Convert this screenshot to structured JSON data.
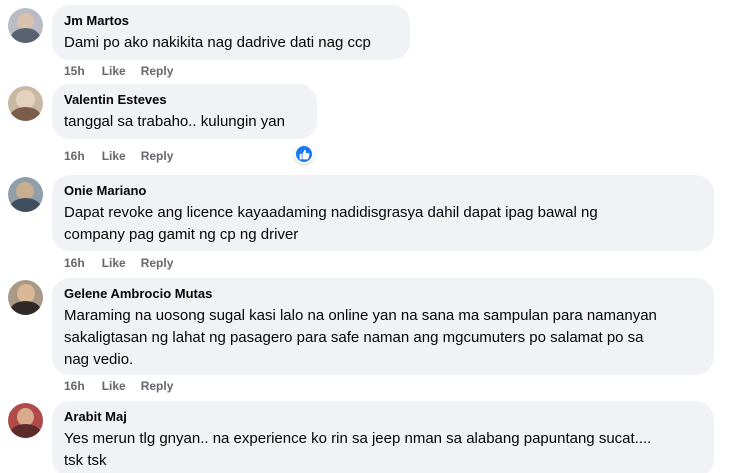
{
  "comments": [
    {
      "name": "Jm Martos",
      "text": "Dami po ako nakikita nag dadrive dati nag ccp",
      "time": "15h",
      "like": "Like",
      "reply": "Reply"
    },
    {
      "name": "Valentin Esteves",
      "text": "tanggal sa trabaho.. kulungin yan",
      "time": "16h",
      "like": "Like",
      "reply": "Reply",
      "reaction": "like-reaction-icon"
    },
    {
      "name": "Onie Mariano",
      "text_lines": [
        "Dapat revoke ang licence kayaadaming nadidisgrasya dahil dapat ipag bawal ng",
        "company pag gamit ng cp ng driver"
      ],
      "time": "16h",
      "like": "Like",
      "reply": "Reply"
    },
    {
      "name": "Gelene Ambrocio Mutas",
      "text_lines": [
        "Maraming na uosong sugal kasi lalo na online yan na sana ma sampulan para namanyan",
        "sakaligtasan ng lahat ng pasagero para safe naman ang mgcumuters po salamat po sa",
        "nag vedio."
      ],
      "time": "16h",
      "like": "Like",
      "reply": "Reply"
    },
    {
      "name": "Arabit Maj",
      "text_lines": [
        "Yes merun tlg gnyan.. na experience ko rin sa jeep nman sa alabang papuntang sucat....",
        "tsk tsk"
      ]
    }
  ],
  "colors": {
    "bubble": "#f0f2f5",
    "meta": "#65676b",
    "like_blue": "#1877f2"
  }
}
